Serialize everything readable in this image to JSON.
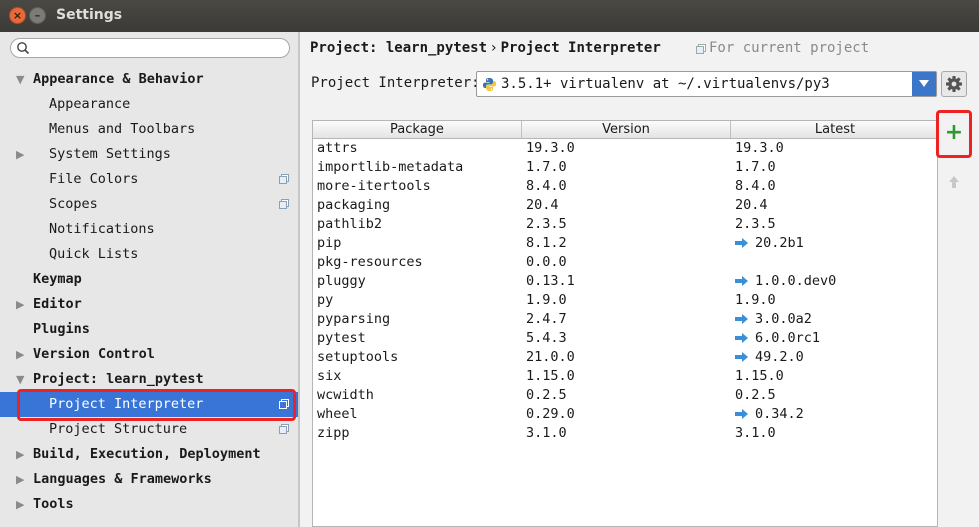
{
  "window": {
    "title": "Settings"
  },
  "sidebar": {
    "search_placeholder": "",
    "items": [
      {
        "label": "Appearance & Behavior",
        "level": 0,
        "arrow": "expanded"
      },
      {
        "label": "Appearance",
        "level": 1
      },
      {
        "label": "Menus and Toolbars",
        "level": 1
      },
      {
        "label": "System Settings",
        "level": 1,
        "arrow": "collapsed"
      },
      {
        "label": "File Colors",
        "level": 1,
        "copy_icon": true
      },
      {
        "label": "Scopes",
        "level": 1,
        "copy_icon": true
      },
      {
        "label": "Notifications",
        "level": 1
      },
      {
        "label": "Quick Lists",
        "level": 1
      },
      {
        "label": "Keymap",
        "level": 0
      },
      {
        "label": "Editor",
        "level": 0,
        "arrow": "collapsed"
      },
      {
        "label": "Plugins",
        "level": 0
      },
      {
        "label": "Version Control",
        "level": 0,
        "arrow": "collapsed"
      },
      {
        "label": "Project: learn_pytest",
        "level": 0,
        "arrow": "expanded"
      },
      {
        "label": "Project Interpreter",
        "level": 1,
        "copy_icon": true,
        "selected": true
      },
      {
        "label": "Project Structure",
        "level": 1,
        "copy_icon": true
      },
      {
        "label": "Build, Execution, Deployment",
        "level": 0,
        "arrow": "collapsed"
      },
      {
        "label": "Languages & Frameworks",
        "level": 0,
        "arrow": "collapsed"
      },
      {
        "label": "Tools",
        "level": 0,
        "arrow": "collapsed"
      }
    ]
  },
  "breadcrumb": {
    "project": "Project: learn_pytest",
    "separator": "›",
    "page": "Project Interpreter",
    "note": "For current project"
  },
  "interpreter": {
    "label": "Project Interpreter:",
    "value": "3.5.1+ virtualenv at ~/.virtualenvs/py3"
  },
  "packages": {
    "headers": [
      "Package",
      "Version",
      "Latest"
    ],
    "rows": [
      {
        "package": "attrs",
        "version": "19.3.0",
        "latest": "19.3.0",
        "upgrade": false
      },
      {
        "package": "importlib-metadata",
        "version": "1.7.0",
        "latest": "1.7.0",
        "upgrade": false
      },
      {
        "package": "more-itertools",
        "version": "8.4.0",
        "latest": "8.4.0",
        "upgrade": false
      },
      {
        "package": "packaging",
        "version": "20.4",
        "latest": "20.4",
        "upgrade": false
      },
      {
        "package": "pathlib2",
        "version": "2.3.5",
        "latest": "2.3.5",
        "upgrade": false
      },
      {
        "package": "pip",
        "version": "8.1.2",
        "latest": "20.2b1",
        "upgrade": true
      },
      {
        "package": "pkg-resources",
        "version": "0.0.0",
        "latest": "",
        "upgrade": false
      },
      {
        "package": "pluggy",
        "version": "0.13.1",
        "latest": "1.0.0.dev0",
        "upgrade": true
      },
      {
        "package": "py",
        "version": "1.9.0",
        "latest": "1.9.0",
        "upgrade": false
      },
      {
        "package": "pyparsing",
        "version": "2.4.7",
        "latest": "3.0.0a2",
        "upgrade": true
      },
      {
        "package": "pytest",
        "version": "5.4.3",
        "latest": "6.0.0rc1",
        "upgrade": true
      },
      {
        "package": "setuptools",
        "version": "21.0.0",
        "latest": "49.2.0",
        "upgrade": true
      },
      {
        "package": "six",
        "version": "1.15.0",
        "latest": "1.15.0",
        "upgrade": false
      },
      {
        "package": "wcwidth",
        "version": "0.2.5",
        "latest": "0.2.5",
        "upgrade": false
      },
      {
        "package": "wheel",
        "version": "0.29.0",
        "latest": "0.34.2",
        "upgrade": true
      },
      {
        "package": "zipp",
        "version": "3.1.0",
        "latest": "3.1.0",
        "upgrade": false
      }
    ]
  },
  "toolbar": {
    "add_symbol": "+"
  },
  "icons": {
    "copy": "copy-icon",
    "upgrade": "upgrade-arrow-icon",
    "python": "python-icon",
    "gear": "gear-icon",
    "search": "search-icon",
    "up": "up-arrow-icon"
  },
  "colors": {
    "selection": "#3875d7",
    "upgrade_arrow": "#3b8fd6",
    "add_button": "#2e9a2e",
    "highlight_box": "#ee2222"
  }
}
